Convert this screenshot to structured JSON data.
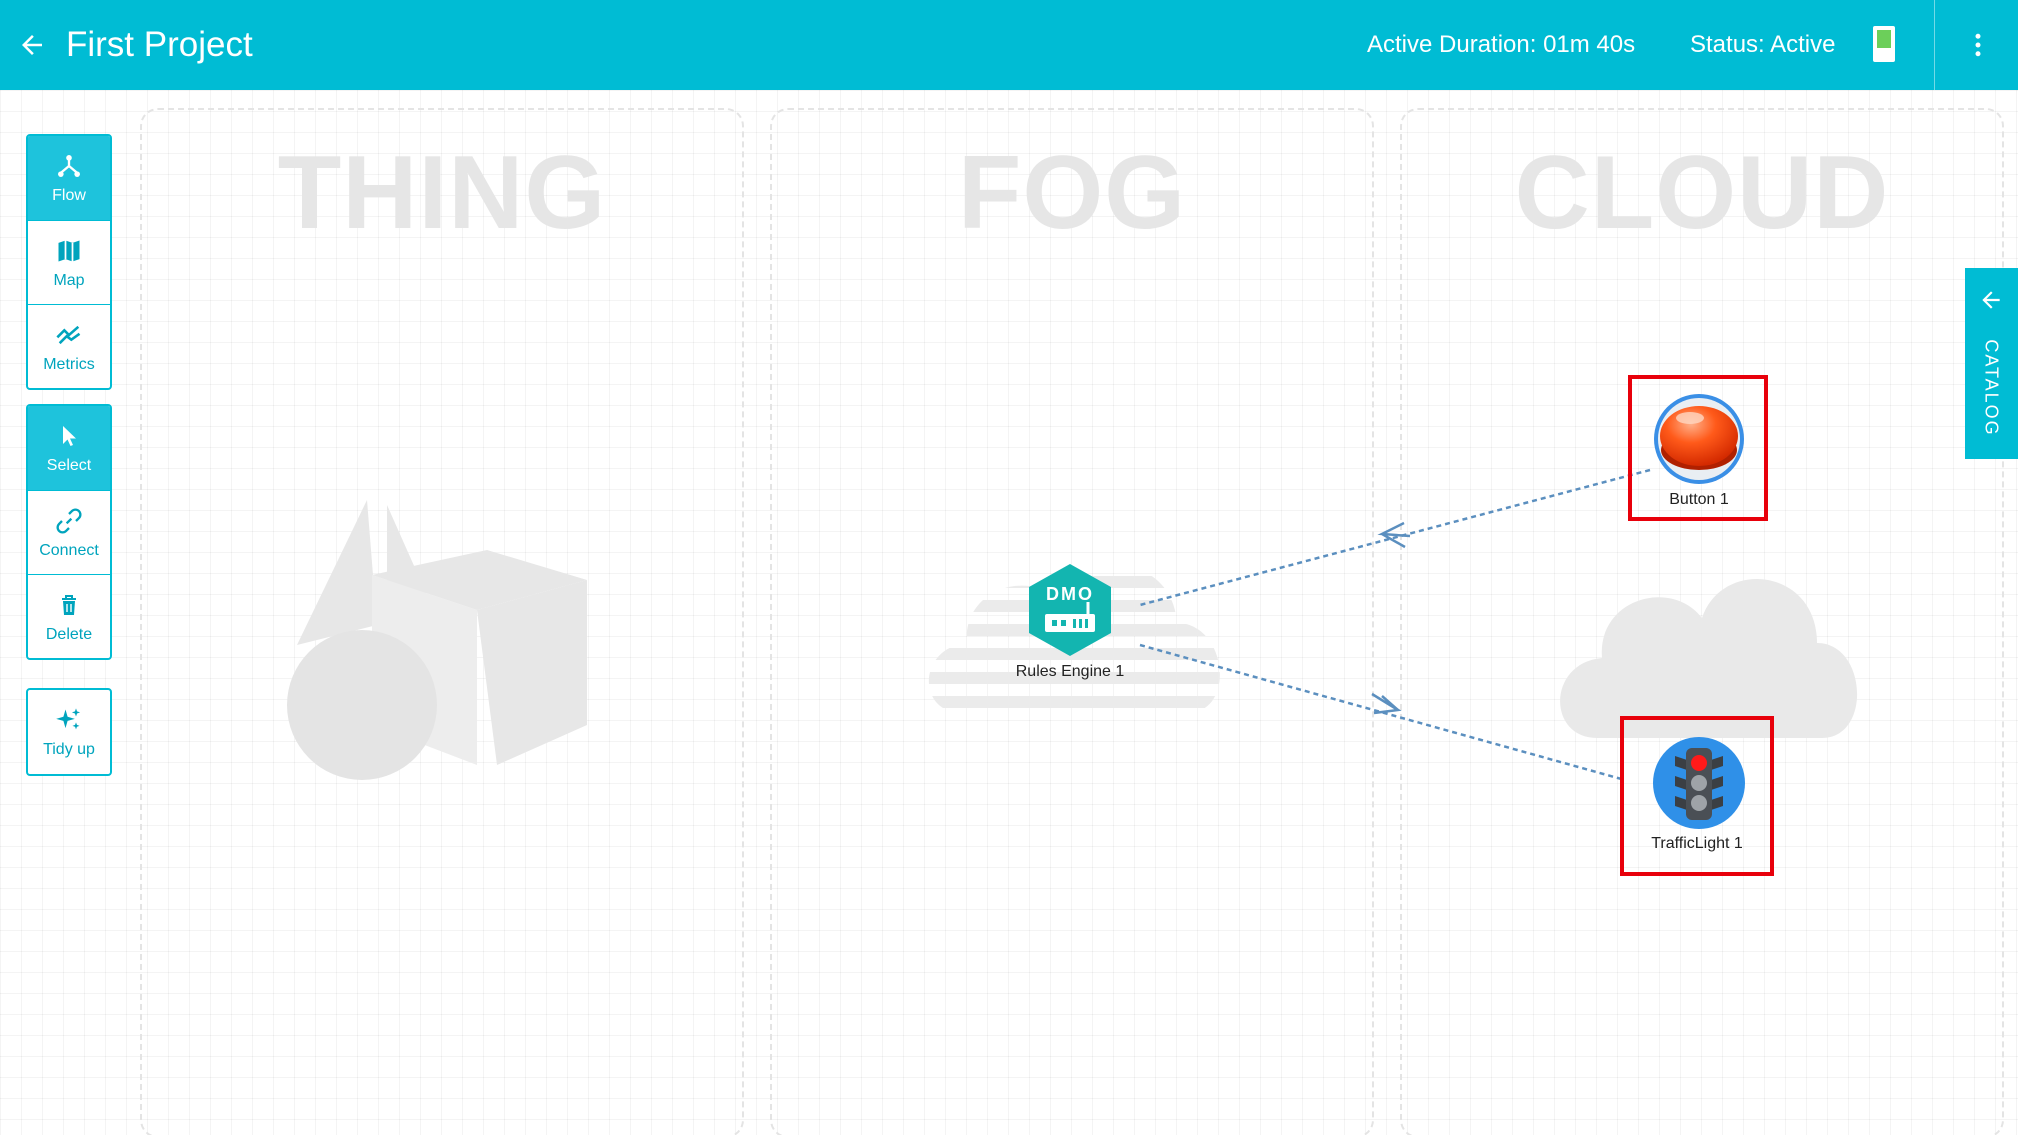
{
  "header": {
    "title": "First Project",
    "duration_label": "Active Duration:",
    "duration_value": "01m 40s",
    "status_label": "Status:",
    "status_value": "Active",
    "status_color": "#6ccf5a",
    "accent_color": "#00bcd4"
  },
  "zones": [
    {
      "title": "THING",
      "watermark_icon": "thing-shapes-icon"
    },
    {
      "title": "FOG",
      "watermark_icon": "fog-cloud-icon"
    },
    {
      "title": "CLOUD",
      "watermark_icon": "cloud-icon"
    }
  ],
  "toolbar": {
    "view_tools": [
      {
        "label": "Flow",
        "icon": "flow-icon",
        "active": true
      },
      {
        "label": "Map",
        "icon": "map-icon",
        "active": false
      },
      {
        "label": "Metrics",
        "icon": "metrics-icon",
        "active": false
      }
    ],
    "edit_tools": [
      {
        "label": "Select",
        "icon": "cursor-icon",
        "active": true
      },
      {
        "label": "Connect",
        "icon": "link-icon",
        "active": false
      },
      {
        "label": "Delete",
        "icon": "trash-icon",
        "active": false
      }
    ],
    "extra_tools": [
      {
        "label": "Tidy up",
        "icon": "sparkle-icon",
        "active": false
      }
    ]
  },
  "catalog": {
    "label": "CATALOG"
  },
  "nodes": {
    "rules_engine": {
      "label": "Rules Engine 1",
      "icon": "rules-engine-icon",
      "badge_text": "DMO"
    },
    "button": {
      "label": "Button 1",
      "icon": "red-button-icon"
    },
    "traffic_light": {
      "label": "TrafficLight 1",
      "icon": "traffic-light-icon"
    }
  },
  "connections": [
    {
      "from": "Button 1",
      "to": "Rules Engine 1"
    },
    {
      "from": "Rules Engine 1",
      "to": "TrafficLight 1"
    }
  ]
}
